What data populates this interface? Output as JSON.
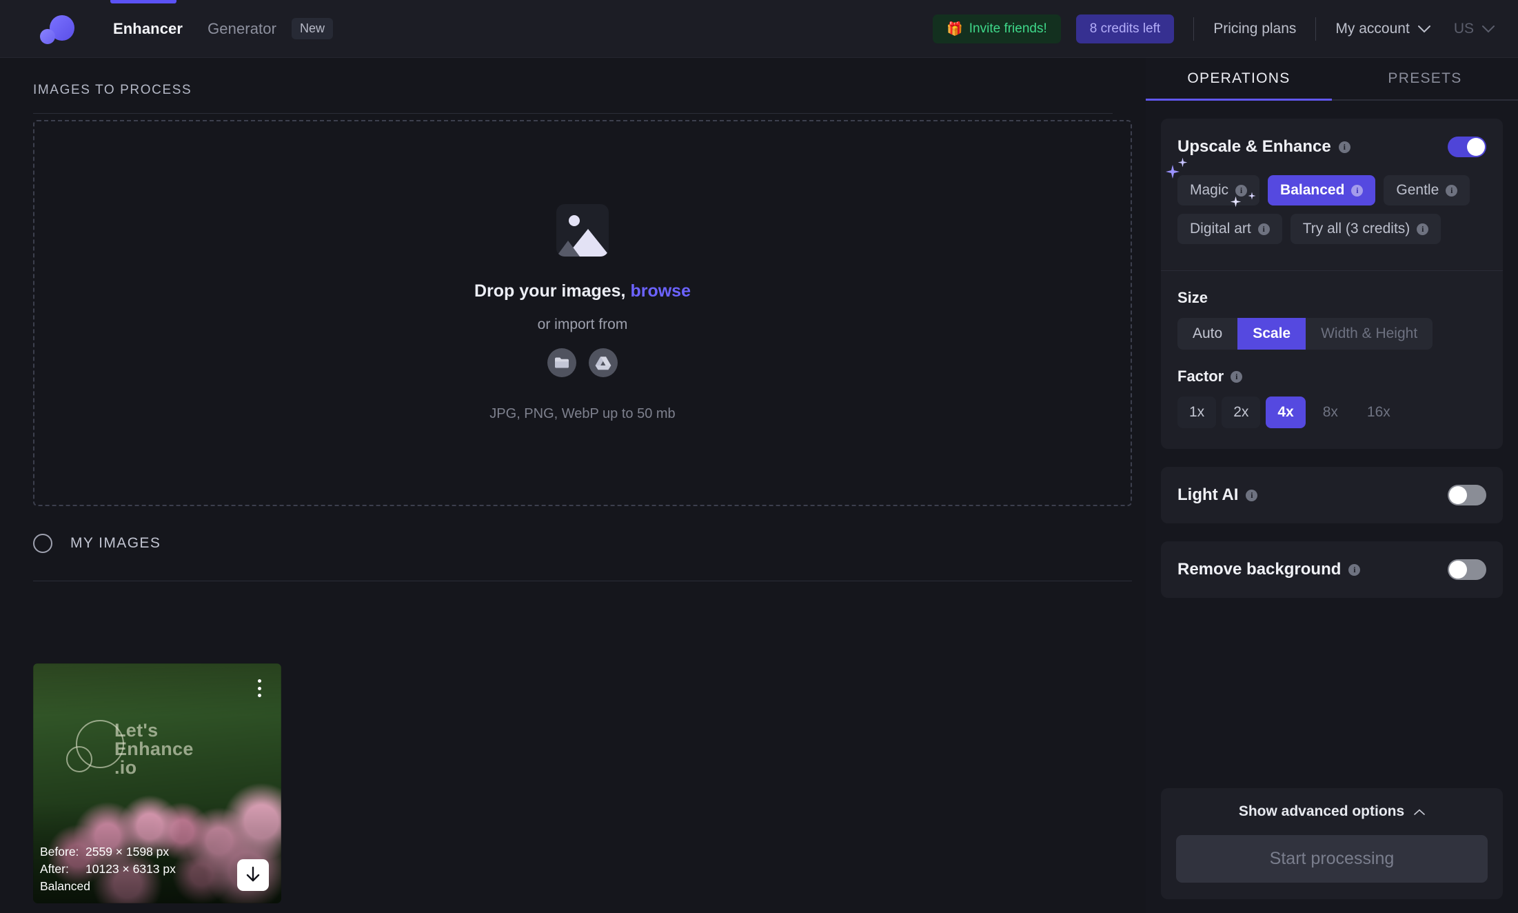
{
  "header": {
    "logo_icon": "lets-enhance-logo",
    "nav": [
      {
        "label": "Enhancer",
        "active": true
      },
      {
        "label": "Generator",
        "active": false
      }
    ],
    "new_badge": "New",
    "invite": {
      "icon": "gift-icon",
      "label": "Invite friends!"
    },
    "credits": "8 credits left",
    "pricing": "Pricing plans",
    "account": "My account",
    "locale": "US"
  },
  "main": {
    "section_title": "IMAGES TO PROCESS",
    "dropzone": {
      "icon": "image-placeholder-icon",
      "title_prefix": "Drop your images,",
      "browse": "browse",
      "sub": "or import from",
      "import_sources": [
        "folder-icon",
        "google-drive-icon"
      ],
      "formats": "JPG, PNG, WebP up to 50 mb"
    },
    "my_images": {
      "label": "MY IMAGES",
      "cards": [
        {
          "watermark": "Let's\nEnhance\n.io",
          "watermark_line1": "Let's",
          "watermark_line2": "Enhance",
          "watermark_line3": ".io",
          "before_label": "Before:",
          "before_value": "2559 × 1598 px",
          "after_label": "After:",
          "after_value": "10123 × 6313 px",
          "mode": "Balanced",
          "menu_icon": "kebab-menu-icon",
          "download_icon": "download-icon"
        }
      ]
    }
  },
  "panel": {
    "tabs": [
      {
        "label": "OPERATIONS",
        "active": true
      },
      {
        "label": "PRESETS",
        "active": false
      }
    ],
    "upscale": {
      "title": "Upscale & Enhance",
      "info": "i",
      "enabled": true,
      "modes": [
        {
          "label": "Magic",
          "active": false
        },
        {
          "label": "Balanced",
          "active": true
        },
        {
          "label": "Gentle",
          "active": false
        },
        {
          "label": "Digital art",
          "active": false
        },
        {
          "label": "Try all (3 credits)",
          "active": false
        }
      ],
      "size": {
        "title": "Size",
        "options": [
          {
            "label": "Auto",
            "active": false,
            "disabled": false
          },
          {
            "label": "Scale",
            "active": true,
            "disabled": false
          },
          {
            "label": "Width & Height",
            "active": false,
            "disabled": true
          }
        ]
      },
      "factor": {
        "title": "Factor",
        "info": "i",
        "options": [
          {
            "label": "1x",
            "active": false,
            "disabled": false
          },
          {
            "label": "2x",
            "active": false,
            "disabled": false
          },
          {
            "label": "4x",
            "active": true,
            "disabled": false
          },
          {
            "label": "8x",
            "active": false,
            "disabled": true
          },
          {
            "label": "16x",
            "active": false,
            "disabled": true
          }
        ]
      }
    },
    "light_ai": {
      "title": "Light AI",
      "info": "i",
      "enabled": false
    },
    "remove_bg": {
      "title": "Remove background",
      "info": "i",
      "enabled": false
    },
    "advanced": {
      "label": "Show advanced options",
      "icon": "chevron-up-icon"
    },
    "start": {
      "label": "Start processing",
      "disabled": true
    }
  },
  "colors": {
    "accent": "#5549e0",
    "accent_bright": "#6c63ff",
    "credits_bg": "#363091",
    "invite_green": "#3fd98a",
    "panel_bg": "#16171e",
    "card_bg": "#1e1f27",
    "page_bg": "#15161c"
  }
}
